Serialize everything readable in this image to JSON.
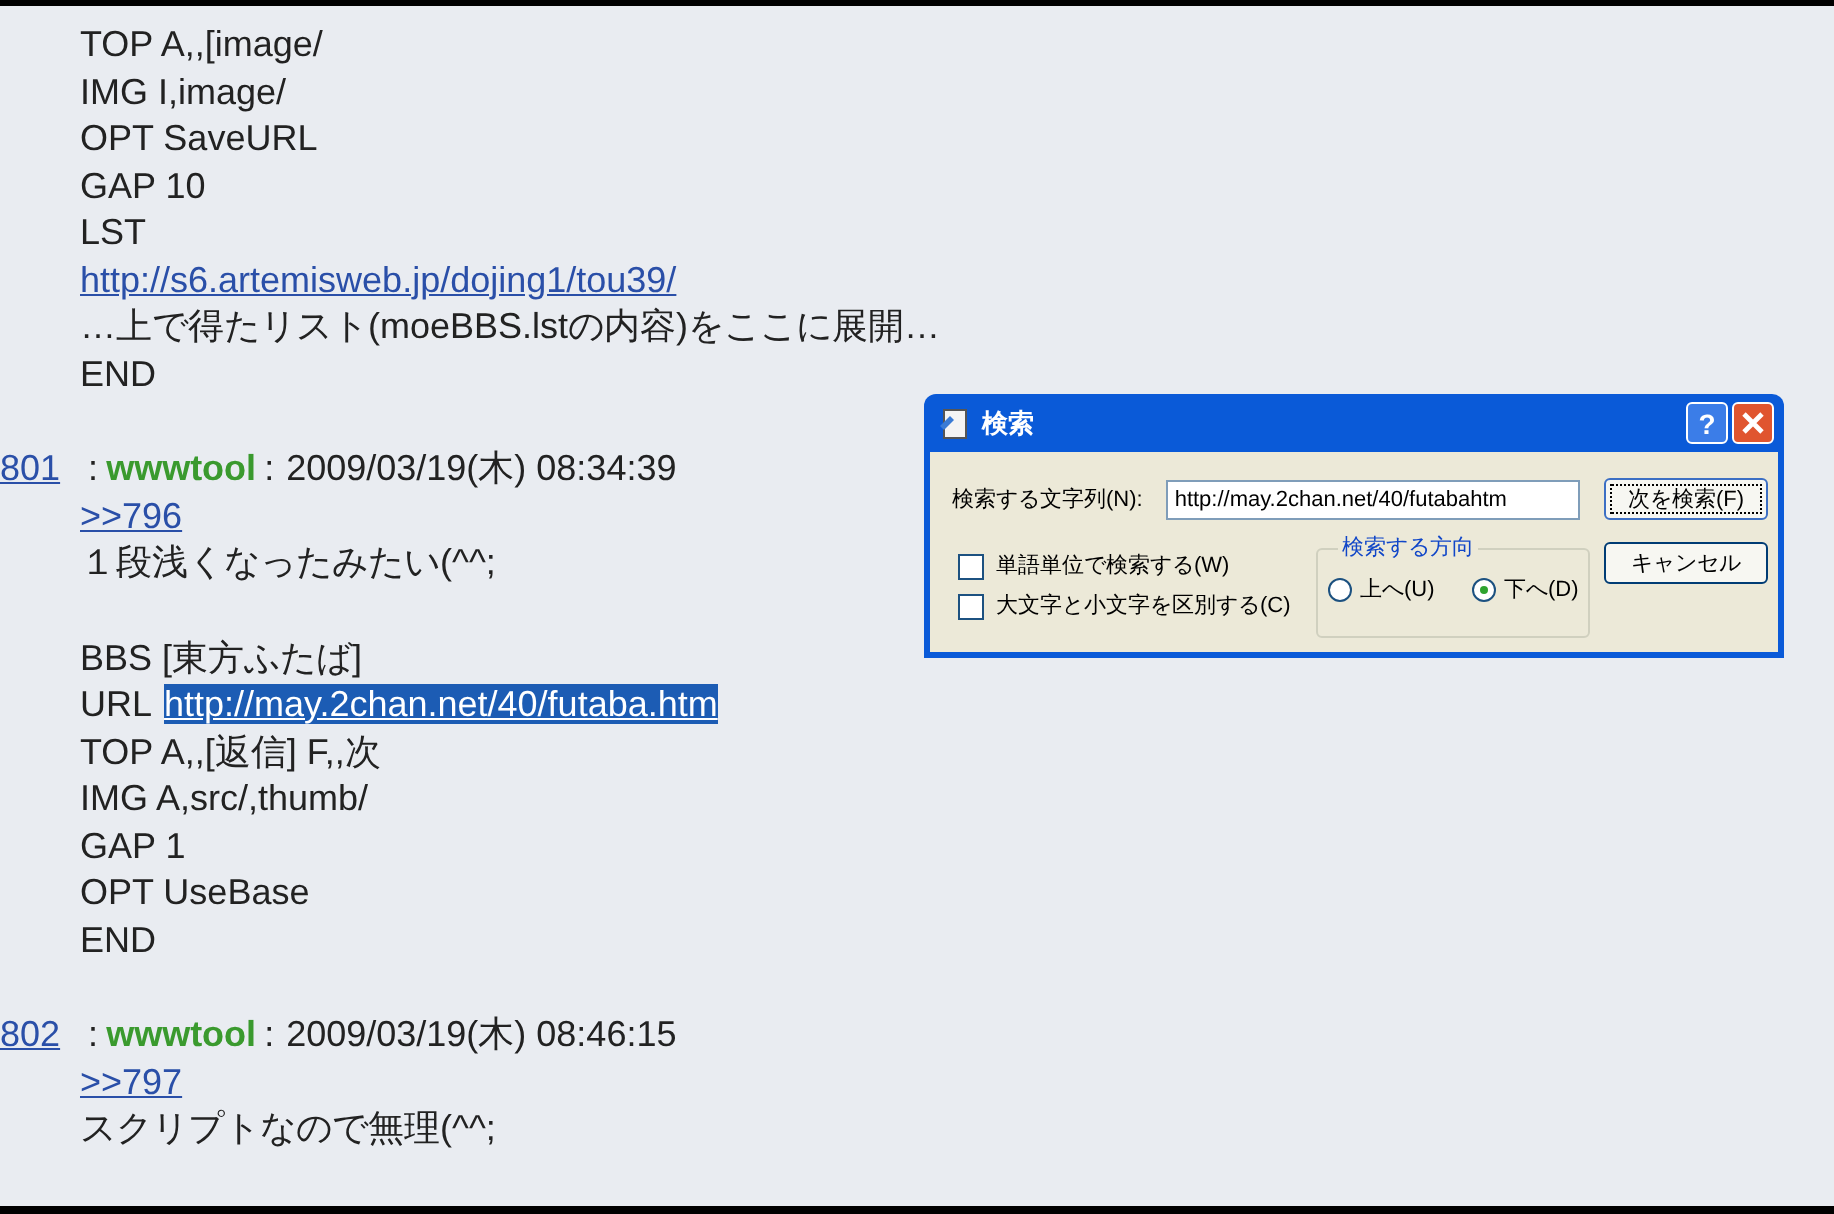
{
  "top_block": {
    "lines": [
      {
        "kind": "text",
        "text": "TOP A,,[image/"
      },
      {
        "kind": "text",
        "text": "IMG I,image/"
      },
      {
        "kind": "text",
        "text": "OPT SaveURL"
      },
      {
        "kind": "text",
        "text": "GAP 10"
      },
      {
        "kind": "text",
        "text": "LST"
      },
      {
        "kind": "link",
        "text": "http://s6.artemisweb.jp/dojing1/tou39/"
      },
      {
        "kind": "text",
        "text": "…上で得たリスト(moeBBS.lstの内容)をここに展開…"
      },
      {
        "kind": "text",
        "text": "END"
      }
    ]
  },
  "posts": [
    {
      "number": "801",
      "separator": ":",
      "author": "wwwtool",
      "date": "2009/03/19(木) 08:34:39",
      "lines": [
        {
          "kind": "link",
          "text": ">>796"
        },
        {
          "kind": "text",
          "text": "１段浅くなったみたい(^^;"
        },
        {
          "kind": "text",
          "text": "BBS [東方ふたば]",
          "gap_before": true
        },
        {
          "kind": "text_with_link",
          "text": "URL",
          "link": "http://may.2chan.net/40/futaba.htm",
          "highlighted": true
        },
        {
          "kind": "text",
          "text": "TOP A,,[返信] F,,次"
        },
        {
          "kind": "text",
          "text": "IMG A,src/,thumb/"
        },
        {
          "kind": "text",
          "text": "GAP 1"
        },
        {
          "kind": "text",
          "text": "OPT UseBase"
        },
        {
          "kind": "text",
          "text": "END"
        }
      ]
    },
    {
      "number": "802",
      "separator": ":",
      "author": "wwwtool",
      "date": "2009/03/19(木) 08:46:15",
      "lines": [
        {
          "kind": "link",
          "text": ">>797"
        },
        {
          "kind": "text",
          "text": "スクリプトなので無理(^^;"
        }
      ]
    }
  ],
  "find_dialog": {
    "title": "検索",
    "help": "?",
    "find_label": "検索する文字列(N):",
    "find_value": "http://may.2chan.net/40/futabahtm",
    "buttons": [
      {
        "label": "次を検索(F)",
        "default": true
      },
      {
        "label": "キャンセル",
        "default": false
      }
    ],
    "checkboxes": [
      {
        "label": "単語単位で検索する(W)",
        "checked": false
      },
      {
        "label": "大文字と小文字を区別する(C)",
        "checked": false
      }
    ],
    "direction": {
      "title": "検索する方向",
      "options": [
        {
          "label": "上へ(U)",
          "selected": false
        },
        {
          "label": "下へ(D)",
          "selected": true
        }
      ]
    }
  }
}
